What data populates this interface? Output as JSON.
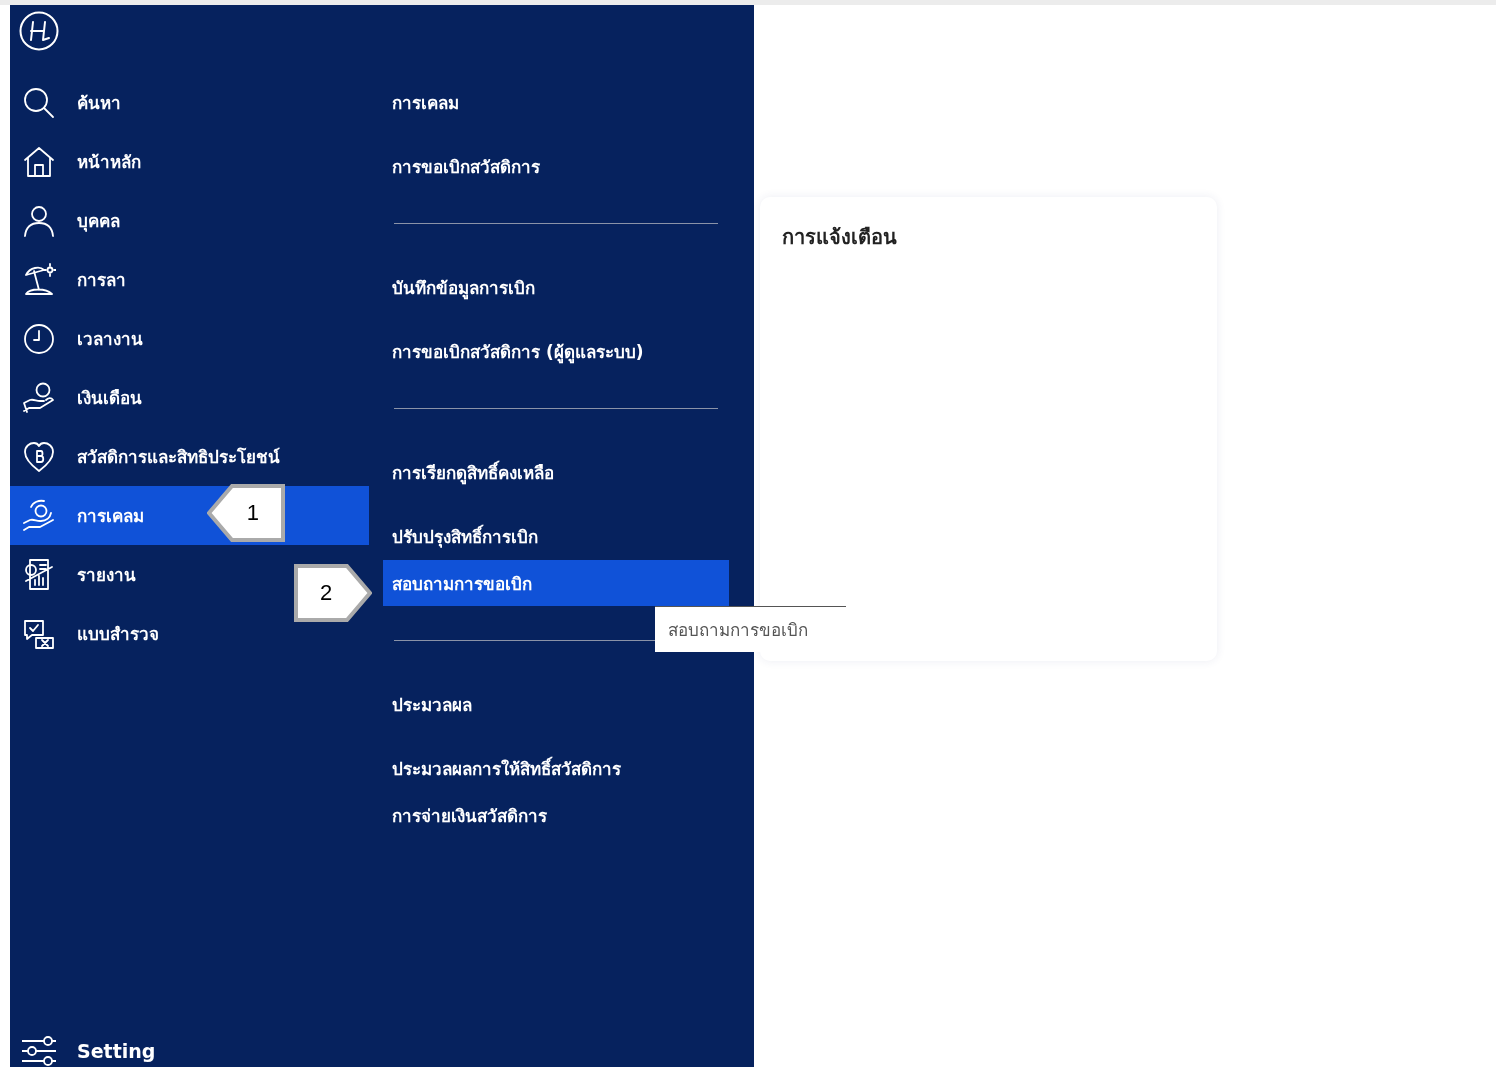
{
  "sidebar": {
    "items": [
      {
        "label": "ค้นหา",
        "selected": false
      },
      {
        "label": "หน้าหลัก",
        "selected": false
      },
      {
        "label": "บุคคล",
        "selected": false
      },
      {
        "label": "การลา",
        "selected": false
      },
      {
        "label": "เวลางาน",
        "selected": false
      },
      {
        "label": "เงินเดือน",
        "selected": false
      },
      {
        "label": "สวัสดิการและสิทธิประโยชน์",
        "selected": false
      },
      {
        "label": "การเคลม",
        "selected": true
      },
      {
        "label": "รายงาน",
        "selected": false
      },
      {
        "label": "แบบสำรวจ",
        "selected": false
      }
    ],
    "footer_item": {
      "label": "Setting"
    }
  },
  "submenu": {
    "groups": [
      {
        "items": [
          {
            "label": "การเคลม",
            "selected": false
          },
          {
            "label": "การขอเบิกสวัสดิการ",
            "selected": false
          }
        ]
      },
      {
        "items": [
          {
            "label": "บันทึกข้อมูลการเบิก",
            "selected": false
          },
          {
            "label": "การขอเบิกสวัสดิการ (ผู้ดูแลระบบ)",
            "selected": false
          }
        ]
      },
      {
        "items": [
          {
            "label": "การเรียกดูสิทธิ์คงเหลือ",
            "selected": false
          },
          {
            "label": "ปรับปรุงสิทธิ์การเบิก",
            "selected": false
          },
          {
            "label": "สอบถามการขอเบิก",
            "selected": true
          }
        ]
      },
      {
        "items": [
          {
            "label": "ประมวลผล",
            "selected": false
          },
          {
            "label": "ประมวลผลการให้สิทธิ์สวัสดิการ",
            "selected": false
          },
          {
            "label": "การจ่ายเงินสวัสดิการ",
            "selected": false
          }
        ]
      }
    ]
  },
  "tooltip": {
    "text": "สอบถามการขอเบิก"
  },
  "notification_card": {
    "title": "การแจ้งเตือน"
  },
  "callouts": [
    {
      "label": "1"
    },
    {
      "label": "2"
    }
  ]
}
